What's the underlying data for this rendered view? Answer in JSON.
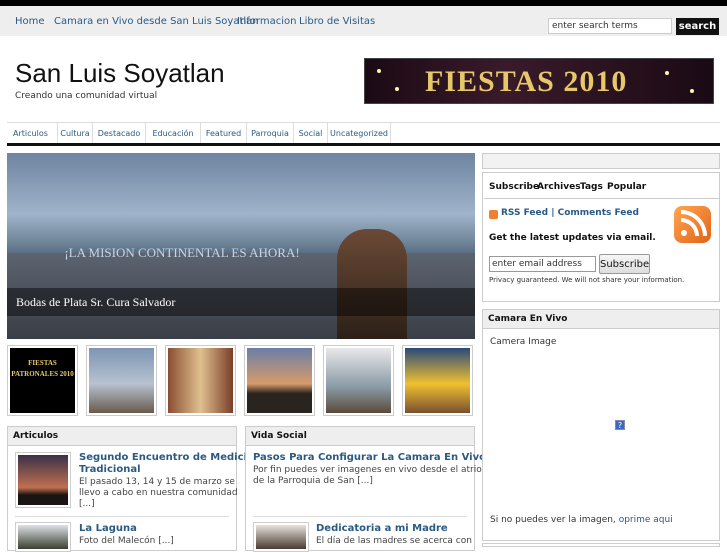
{
  "nav": {
    "items": [
      "Home",
      "Camara en Vivo desde San Luis Soyatlan",
      "Informacion",
      "Libro de Visitas"
    ]
  },
  "search": {
    "value": "enter search terms",
    "button": "search"
  },
  "header": {
    "title": "San Luis Soyatlan",
    "tagline": "Creando una comunidad virtual",
    "banner_text": "FIESTAS 2010"
  },
  "categories": [
    "Articulos",
    "Cultura",
    "Destacado",
    "Educación",
    "Featured",
    "Parroquia",
    "Social",
    "Uncategorized"
  ],
  "featured": {
    "sign_text": "¡LA MISION CONTINENTAL ES AHORA!",
    "caption": "Bodas de Plata Sr. Cura Salvador"
  },
  "thumbnails": {
    "first_text": "FIESTAS PATRONALES 2010"
  },
  "articulos": {
    "heading": "Articulos",
    "posts": [
      {
        "title_l1": "Segundo Encuentro de Medicina",
        "title_l2": "Tradicional",
        "excerpt_l1": "El pasado 13, 14 y 15 de marzo se",
        "excerpt_l2": "llevo a cabo en nuestra comunidad",
        "excerpt_l3": "[...]"
      },
      {
        "title_l1": "La Laguna",
        "excerpt_l1": "Foto del Malecón [...]"
      }
    ]
  },
  "vida_social": {
    "heading": "Vida Social",
    "posts": [
      {
        "title_l1": "Pasos Para Configurar La Camara En Vivo",
        "excerpt_l1": "Por fin puedes ver imagenes en vivo desde el atrio",
        "excerpt_l2": "de la Parroquia de San [...]"
      },
      {
        "title_l1": "Dedicatoria a mi Madre",
        "excerpt_l1": "El día de las madres se acerca con"
      }
    ]
  },
  "sidebar": {
    "tabs": [
      "Subscribe",
      "Archives",
      "Tags",
      "Popular"
    ],
    "rss_feed": "RSS Feed",
    "divider": "|",
    "comments_feed": "Comments Feed",
    "updates_text": "Get the latest updates via email.",
    "email_value": "enter email address",
    "subscribe_button": "Subscribe",
    "privacy": "Privacy guaranteed. We will not share your information.",
    "camera_heading": "Camara En Vivo",
    "camera_image": "Camera Image",
    "camera_broken": "?",
    "camera_note": "Si no puedes ver la imagen,",
    "camera_link": "oprime aqui"
  }
}
